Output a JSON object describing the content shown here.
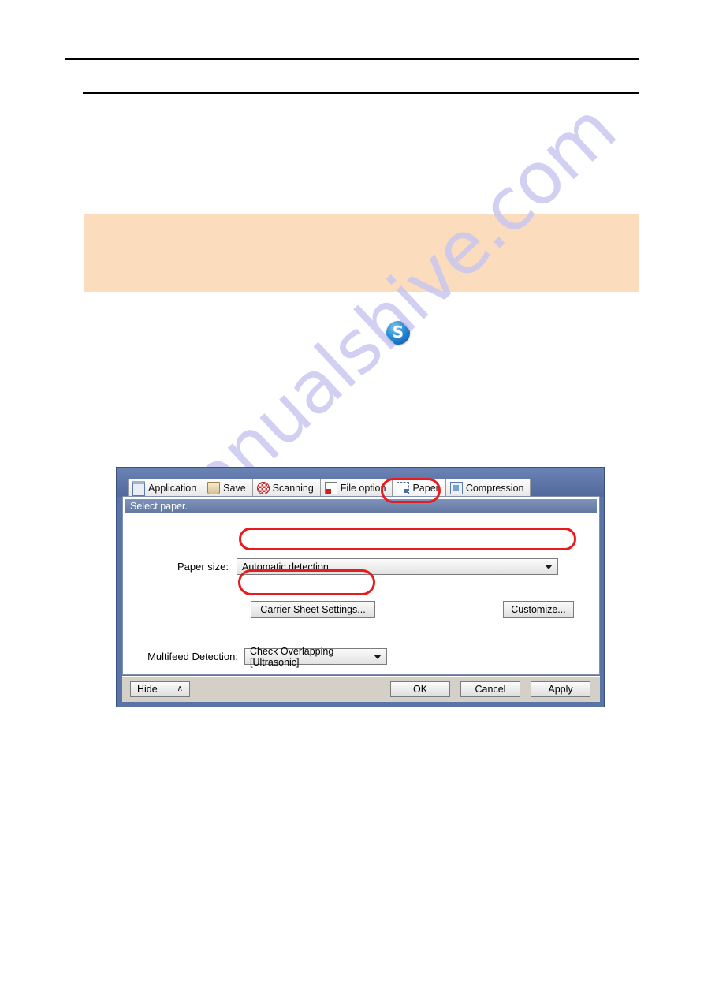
{
  "document": {
    "watermark": "manualshive.com",
    "note_box": {
      "text": "",
      "color": "#fbdcbd"
    }
  },
  "logo": {
    "name": "scansnap-logo",
    "glyph": "S",
    "color": "#1668b5"
  },
  "dialog": {
    "tabs": [
      {
        "label": "Application",
        "icon": "application-icon",
        "active": false
      },
      {
        "label": "Save",
        "icon": "save-icon",
        "active": false
      },
      {
        "label": "Scanning",
        "icon": "scanning-icon",
        "active": false
      },
      {
        "label": "File option",
        "icon": "file-option-icon",
        "active": false
      },
      {
        "label": "Paper",
        "icon": "paper-icon",
        "active": true
      },
      {
        "label": "Compression",
        "icon": "compression-icon",
        "active": false
      }
    ],
    "section_title": "Select paper.",
    "paper_size": {
      "label": "Paper size:",
      "value": "Automatic detection"
    },
    "carrier_sheet_button": "Carrier Sheet Settings...",
    "customize_button": "Customize...",
    "multifeed": {
      "label": "Multifeed Detection:",
      "value": "Check Overlapping [Ultrasonic]"
    },
    "footer": {
      "hide_button": "Hide",
      "hide_chevron": "∧",
      "ok_button": "OK",
      "cancel_button": "Cancel",
      "apply_button": "Apply"
    }
  },
  "annotations": {
    "color": "#e81c1c",
    "targets": [
      "paper-tab",
      "paper-size-combo",
      "carrier-sheet-settings-button"
    ]
  }
}
